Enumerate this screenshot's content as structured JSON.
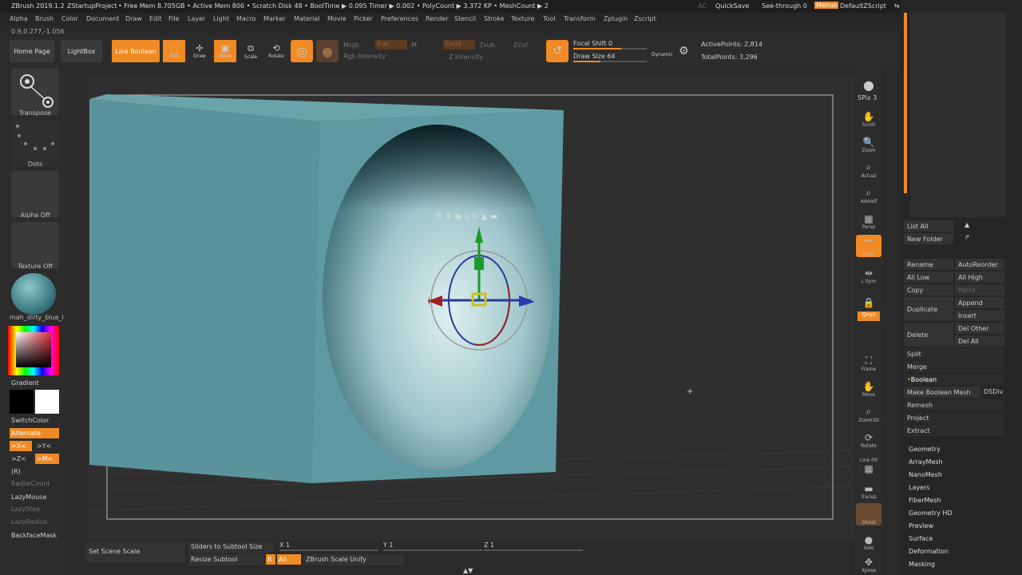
{
  "titlebar": {
    "app": "ZBrush 2019.1.2",
    "project": "ZStartupProject",
    "stats": "• Free Mem 8.705GB • Active Mem 806 • Scratch Disk 48 • BoolTime ▶ 0.095 Timer ▶ 0.002 • PolyCount ▶ 3.372 KP • MeshCount ▶ 2",
    "ac": "AC",
    "quicksave": "QuickSave",
    "seethrough": "See-through  0",
    "menus": "Menus",
    "script": "DefaultZScript"
  },
  "menus": [
    "Alpha",
    "Brush",
    "Color",
    "Document",
    "Draw",
    "Edit",
    "File",
    "Layer",
    "Light",
    "Macro",
    "Marker",
    "Material",
    "Movie",
    "Picker",
    "Preferences",
    "Render",
    "Stencil",
    "Stroke",
    "Texture",
    "Tool",
    "Transform",
    "Zplugin",
    "Zscript"
  ],
  "coordinate": "0.9,0.277,-1.056",
  "toolbar": {
    "home": "Home Page",
    "lightbox": "LightBox",
    "liveboolean": "Live Boolean",
    "edit": "Edit",
    "draw": "Draw",
    "move": "Move",
    "scale": "Scale",
    "rotate": "Rotate",
    "mrgb": "Mrgb",
    "rgb": "Rgb",
    "m": "M",
    "rgb_intensity": "Rgb Intensity",
    "zadd": "Zadd",
    "zsub": "Zsub",
    "zcut": "Zcut",
    "z_intensity": "Z Intensity",
    "focal_shift": "Focal Shift 0",
    "draw_size": "Draw Size 64",
    "dynamic": "Dynamic",
    "active_points": "ActivePoints: 2,814",
    "total_points": "TotalPoints: 3,296"
  },
  "left": {
    "transpose": "Transpose",
    "dots": "Dots",
    "alpha": "Alpha Off",
    "texture": "Texture Off",
    "material": "mah_dirty_blue_l",
    "gradient": "Gradient",
    "switchcolor": "SwitchColor",
    "alternate": "Alternate",
    "xbtn": ">X<",
    "ybtn": ">Y<",
    "zbtn": ">Z<",
    "mbtn": ">M<",
    "r": "(R)",
    "radialcount": "RadialCount",
    "lazymouse": "LazyMouse",
    "lazystep": "LazyStep",
    "lazyradius": "LazyRadius",
    "backfacemask": "BackfaceMask"
  },
  "rightstrip": [
    "BPR",
    "SPix 3",
    "Scroll",
    "Zoom",
    "Actual",
    "AAHalf",
    "Persp",
    "Floor",
    "L.Sym",
    "",
    "Frame",
    "Move",
    "Zoom3D",
    "Rotate",
    "Line Fill",
    "Transp",
    "Ghost",
    "Solo",
    "Xpose"
  ],
  "subtool": {
    "listall": "List All",
    "newfolder": "New Folder",
    "rename": "Rename",
    "autoreorder": "AutoReorder",
    "alllow": "All Low",
    "allhigh": "All High",
    "copy": "Copy",
    "paste": "Paste",
    "duplicate": "Duplicate",
    "append": "Append",
    "insert": "Insert",
    "delete": "Delete",
    "delother": "Del Other",
    "delall": "Del All",
    "split": "Split",
    "merge": "Merge",
    "boolean": "Boolean",
    "makeboolean": "Make Boolean Mesh",
    "dsdiv": "DSDiv",
    "remesh": "Remesh",
    "project": "Project",
    "extract": "Extract"
  },
  "tool_sections": [
    "Geometry",
    "ArrayMesh",
    "NanoMesh",
    "Layers",
    "FiberMesh",
    "Geometry HD",
    "Preview",
    "Surface",
    "Deformation",
    "Masking"
  ],
  "bottom": {
    "setscenescale": "Set Scene Scale",
    "sliders": "Sliders to Subtool Size",
    "resize": "Resize Subtool",
    "x": "X 1",
    "y": "Y 1",
    "z": "Z 1",
    "r": "R",
    "all": "All",
    "unify": "ZBrush Scale Unify"
  },
  "colors": {
    "accent": "#f08a24",
    "mesh": "#5a939b"
  }
}
